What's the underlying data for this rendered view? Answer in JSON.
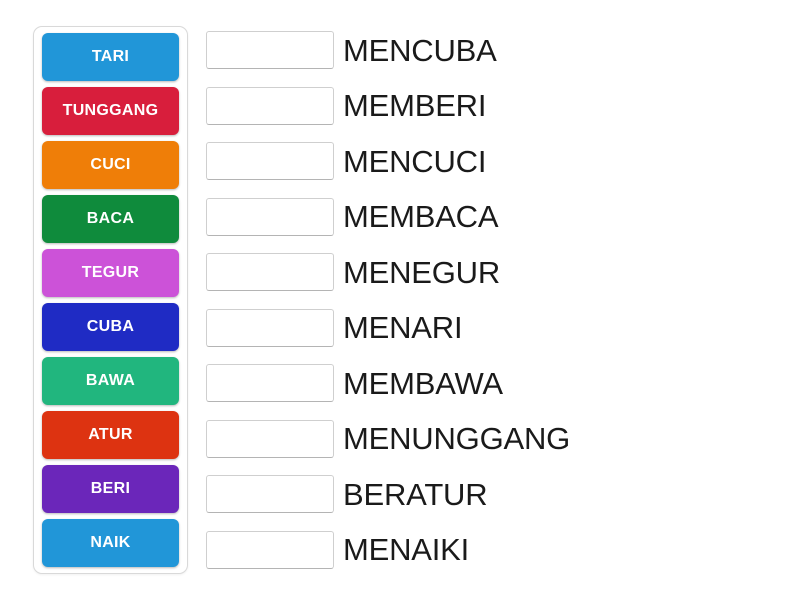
{
  "activity": {
    "type": "match-up",
    "tray_label": "word-tile-tray",
    "answer_list_label": "answer-rows"
  },
  "tiles": [
    {
      "label": "TARI",
      "color": "#2196d8"
    },
    {
      "label": "TUNGGANG",
      "color": "#d81e3c"
    },
    {
      "label": "CUCI",
      "color": "#ef7e08"
    },
    {
      "label": "BACA",
      "color": "#0f8b3c"
    },
    {
      "label": "TEGUR",
      "color": "#cc52d8"
    },
    {
      "label": "CUBA",
      "color": "#1f2bc4"
    },
    {
      "label": "BAWA",
      "color": "#21b67e"
    },
    {
      "label": "ATUR",
      "color": "#dd3311"
    },
    {
      "label": "BERI",
      "color": "#6b26ba"
    },
    {
      "label": "NAIK",
      "color": "#2196d8"
    }
  ],
  "answers": [
    {
      "dropped_value": "",
      "label": "MENCUBA"
    },
    {
      "dropped_value": "",
      "label": "MEMBERI"
    },
    {
      "dropped_value": "",
      "label": "MENCUCI"
    },
    {
      "dropped_value": "",
      "label": "MEMBACA"
    },
    {
      "dropped_value": "",
      "label": "MENEGUR"
    },
    {
      "dropped_value": "",
      "label": "MENARI"
    },
    {
      "dropped_value": "",
      "label": "MEMBAWA"
    },
    {
      "dropped_value": "",
      "label": "MENUNGGANG"
    },
    {
      "dropped_value": "",
      "label": "BERATUR"
    },
    {
      "dropped_value": "",
      "label": "MENAIKI"
    }
  ]
}
